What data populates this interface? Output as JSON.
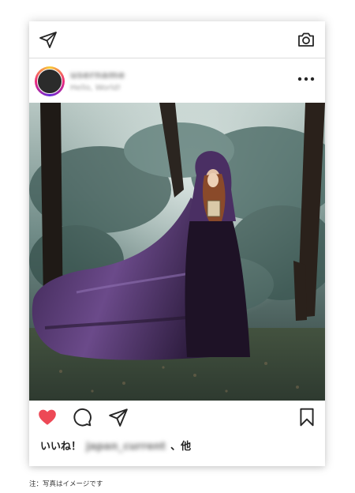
{
  "header": {
    "username": "username",
    "subtitle": "Hello, World!"
  },
  "photo": {
    "icon": "photo-woman-purple-cloak-forest"
  },
  "icons": {
    "direct": "paper-plane-icon",
    "camera": "camera-icon",
    "more": "more-horizontal-icon",
    "like": "heart-icon",
    "comment": "comment-icon",
    "share": "paper-plane-icon",
    "save": "bookmark-icon"
  },
  "colors": {
    "like": "#ed4956",
    "border": "#dbdbdb"
  },
  "likes": {
    "prefix": "いいね！",
    "user": "japan_current",
    "suffix": "、他"
  },
  "footnote": "注：写真はイメージです"
}
